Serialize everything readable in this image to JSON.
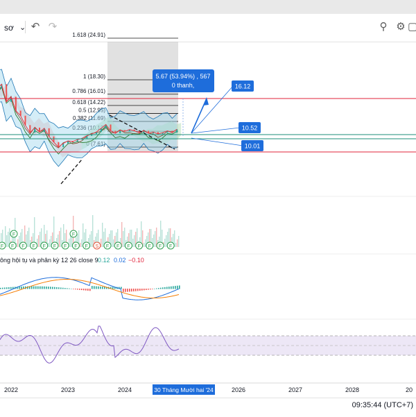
{
  "toolbar": {
    "symbol_fragment": "sơ",
    "undo_icon": "undo-icon",
    "redo_icon": "redo-icon",
    "search_icon": "zoom-search-icon",
    "settings_icon": "gear-icon",
    "fullscreen_icon": "fullscreen-icon"
  },
  "colors": {
    "price_line": "#e63946",
    "bb_fill": "#9fd8ee",
    "bb_line": "#1f77b4",
    "cloud_green": "#b7dfb9",
    "cloud_red": "#f4c7c3",
    "level_red": "#e2233a",
    "level_teal": "#1b8f7a",
    "label_blue": "#1e6ddb",
    "fib_box": "#c8c8c8",
    "rsi_band": "#ede7f6",
    "rsi_line": "#7e57c2"
  },
  "chart_data": {
    "type": "line",
    "x_axis": {
      "ticks": [
        "2022",
        "2023",
        "2024",
        "2025",
        "2026",
        "2027",
        "2028",
        "20"
      ],
      "crosshair_label": "30 Tháng Mười hai '24"
    },
    "fibonacci": [
      {
        "ratio": "1.618",
        "label": "1.618 (24.91)",
        "value": 24.91
      },
      {
        "ratio": "1",
        "label": "1 (18.30)",
        "value": 18.3
      },
      {
        "ratio": "0.786",
        "label": "0.786 (16.01)",
        "value": 16.01
      },
      {
        "ratio": "0.618",
        "label": "0.618 (14.22)",
        "value": 14.22
      },
      {
        "ratio": "0.5",
        "label": "0.5 (12.95)",
        "value": 12.95
      },
      {
        "ratio": "0.382",
        "label": "0.382 (11.69)",
        "value": 11.69
      },
      {
        "ratio": "0.236",
        "label": "0.236 (10.13)",
        "value": 10.13
      },
      {
        "ratio": "0",
        "label": "0 (7.61)",
        "value": 7.61
      }
    ],
    "levels": [
      {
        "label": "16.12",
        "value": 16.12,
        "kind": "resistance"
      },
      {
        "label": "10.52",
        "value": 10.52,
        "kind": "support"
      },
      {
        "label": "10.01",
        "value": 10.01,
        "kind": "support"
      }
    ],
    "measure_tooltip": {
      "line1": "5.67 (53.94%) , 567",
      "line2": "0 thanh,"
    },
    "price_series": [
      [
        "2021-06",
        13.5
      ],
      [
        "2021-08",
        16.5
      ],
      [
        "2021-09",
        18.8
      ],
      [
        "2021-10",
        16.9
      ],
      [
        "2021-11",
        17.6
      ],
      [
        "2021-12",
        14.8
      ],
      [
        "2022-01",
        15.6
      ],
      [
        "2022-02",
        13.4
      ],
      [
        "2022-03",
        12.6
      ],
      [
        "2022-04",
        11.1
      ],
      [
        "2022-05",
        9.9
      ],
      [
        "2022-06",
        10.7
      ],
      [
        "2022-07",
        10.0
      ],
      [
        "2022-08",
        10.6
      ],
      [
        "2022-09",
        9.3
      ],
      [
        "2022-10",
        8.4
      ],
      [
        "2022-11",
        7.6
      ],
      [
        "2022-12",
        8.2
      ],
      [
        "2023-01",
        8.6
      ],
      [
        "2023-02",
        8.5
      ],
      [
        "2023-03",
        8.8
      ],
      [
        "2023-04",
        9.0
      ],
      [
        "2023-05",
        9.4
      ],
      [
        "2023-06",
        9.7
      ],
      [
        "2023-07",
        10.0
      ],
      [
        "2023-08",
        10.6
      ],
      [
        "2023-09",
        11.2
      ],
      [
        "2023-10",
        10.2
      ],
      [
        "2023-11",
        9.8
      ],
      [
        "2023-12",
        10.3
      ],
      [
        "2024-01",
        10.1
      ],
      [
        "2024-02",
        10.4
      ],
      [
        "2024-03",
        10.2
      ],
      [
        "2024-04",
        9.9
      ],
      [
        "2024-05",
        10.2
      ],
      [
        "2024-06",
        9.8
      ],
      [
        "2024-07",
        10.0
      ],
      [
        "2024-08",
        9.7
      ],
      [
        "2024-09",
        9.9
      ],
      [
        "2024-10",
        10.2
      ],
      [
        "2024-11",
        9.9
      ],
      [
        "2024-12",
        10.45
      ]
    ],
    "volume_signals": {
      "markers": [
        "F",
        "F",
        "F",
        "F",
        "F",
        "F",
        "F",
        "F",
        "F",
        "S",
        "F",
        "F",
        "F",
        "F",
        "F",
        "F",
        "F"
      ],
      "upper_markers": [
        "F",
        "F"
      ]
    },
    "macd": {
      "legend_prefix": "ông hội tụ và phân kỳ 12 26 close 9",
      "legend_values": [
        "0.12",
        "0.02",
        "−0.10"
      ]
    },
    "rsi": {
      "band": [
        30,
        70
      ],
      "last": 62
    }
  },
  "status": {
    "time": "09:35:44 (UTC+7)"
  }
}
